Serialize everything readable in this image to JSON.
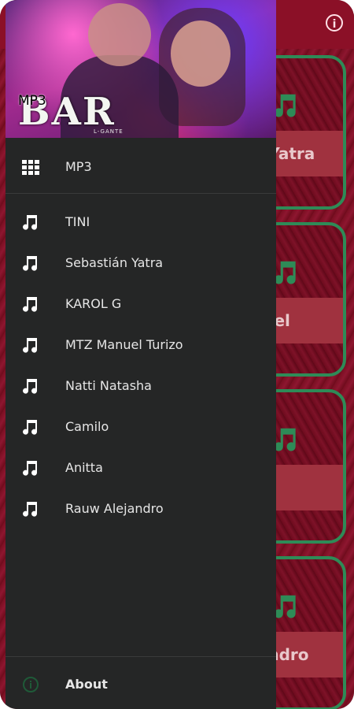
{
  "header": {
    "banner_title": "BAR",
    "banner_subtitle": "L-GANTE",
    "app_name": "MP3"
  },
  "info_icon": "info-icon",
  "background_cards": [
    {
      "label": "n Yatra"
    },
    {
      "label": "nuel"
    },
    {
      "label": ""
    },
    {
      "label": "jandro"
    }
  ],
  "menu": {
    "top_item": {
      "icon": "grid-icon",
      "label": "MP3"
    },
    "artists": [
      {
        "icon": "music-note-icon",
        "label": "TINI"
      },
      {
        "icon": "music-note-icon",
        "label": "Sebastián Yatra"
      },
      {
        "icon": "music-note-icon",
        "label": "KAROL G"
      },
      {
        "icon": "music-note-icon",
        "label": "MTZ Manuel Turizo"
      },
      {
        "icon": "music-note-icon",
        "label": "Natti Natasha"
      },
      {
        "icon": "music-note-icon",
        "label": "Camilo"
      },
      {
        "icon": "music-note-icon",
        "label": "Anitta"
      },
      {
        "icon": "music-note-icon",
        "label": "Rauw Alejandro"
      }
    ],
    "about": {
      "icon": "info-icon",
      "label": "About"
    }
  },
  "colors": {
    "drawer_bg": "#252626",
    "accent_green": "#2e8b57",
    "app_bg": "#8b1027"
  }
}
